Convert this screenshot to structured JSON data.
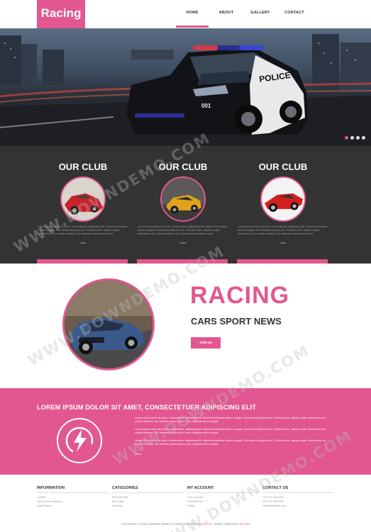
{
  "header": {
    "logo": "Racing",
    "nav": [
      {
        "label": "HOME",
        "active": true
      },
      {
        "label": "ABOUT",
        "active": false
      },
      {
        "label": "GALLERY",
        "active": false
      },
      {
        "label": "CONTACT",
        "active": false
      }
    ]
  },
  "hero": {
    "car_badge": "POLICE",
    "car_number": "001",
    "slides": 4,
    "active_slide": 1
  },
  "clubs": [
    {
      "title": "OUR CLUB",
      "text": "Lorem ipsum dolor sit amet, consectetuer adipiscing elit. Mauris fermentum dictum magna. Sed laoreet aliquam leo. Ut tellus dolor, dapibus eget, elementum vel, cursus eleifend, elit. Aenean auctor wisi et urna.",
      "more": "more",
      "image": "red-car"
    },
    {
      "title": "OUR CLUB",
      "text": "Lorem ipsum dolor sit amet, consectetuer adipiscing elit. Mauris fermentum dictum magna. Sed laoreet aliquam leo. Ut tellus dolor, dapibus eget, elementum vel, cursus eleifend, elit. Aenean auctor wisi et urna.",
      "more": "more",
      "image": "yellow-car"
    },
    {
      "title": "OUR CLUB",
      "text": "Lorem ipsum dolor sit amet, consectetuer adipiscing elit. Mauris fermentum dictum magna. Sed laoreet aliquam leo. Ut tellus dolor, dapibus eget, elementum vel, cursus eleifend, elit. Aenean auctor wisi et urna.",
      "more": "more",
      "image": "red-sports-car"
    }
  ],
  "racing": {
    "title": "RACING",
    "subtitle": "CARS SPORT NEWS",
    "button": "JOIN US"
  },
  "promo": {
    "title": "LOREM IPSUM DOLOR SIT AMET, CONSECTETUER ADIPISCING ELIT",
    "paragraphs": [
      "Lorem ipsum dolor sit amet, consectetuer adipiscing elit. Mauris fermentum dictum magna. Sed laoreet aliquam leo. Ut tellus dolor, dapibus eget, elementum vel, cursus eleifend, elit. Aenean auctor wisi et urna. Aliquam erat volutpat.",
      "Lorem ipsum dolor sit amet, consectetuer adipiscing elit. Mauris fermentum dictum magna. Sed laoreet aliquam leo. Ut tellus dolor, dapibus eget, elementum vel, cursus eleifend, elit. Aenean auctor wisi et urna. Aliquam erat volutpat.",
      "Lorem ipsum dolor sit amet, consectetuer adipiscing elit. Mauris fermentum dictum magna. Sed laoreet aliquam leo. Ut tellus dolor, dapibus eget, elementum vel, cursus eleifend, elit. Aenean auctor wisi et urna. Aliquam erat volutpat."
    ],
    "more": "more"
  },
  "footer": {
    "columns": [
      {
        "heading": "INFORMATION",
        "items": [
          "Contact",
          "Terms and conditions",
          "Legal Notice"
        ]
      },
      {
        "heading": "CATEGORIES",
        "items": [
          "Personal info",
          "My orders",
          "Specials"
        ]
      },
      {
        "heading": "MY ACCOUNT",
        "items": [
          "Your account",
          "Personal info",
          "Prices"
        ]
      },
      {
        "heading": "CONTACT US",
        "items": [
          "+00 123 4567890",
          "+00 123 4567891",
          "info@demolink.org"
        ]
      }
    ],
    "copyright_prefix": "COPYRIGHT © 2014 COMPANY NAME ALL RIGHTS RESERVED",
    "copyright_link1": "DESIGN",
    "copyright_mid": "MORE TEMPLATES",
    "copyright_link2": "RACING"
  },
  "watermark": "WWW.DOWNDEMO.COM",
  "colors": {
    "accent": "#e2578f",
    "dark": "#333333"
  }
}
